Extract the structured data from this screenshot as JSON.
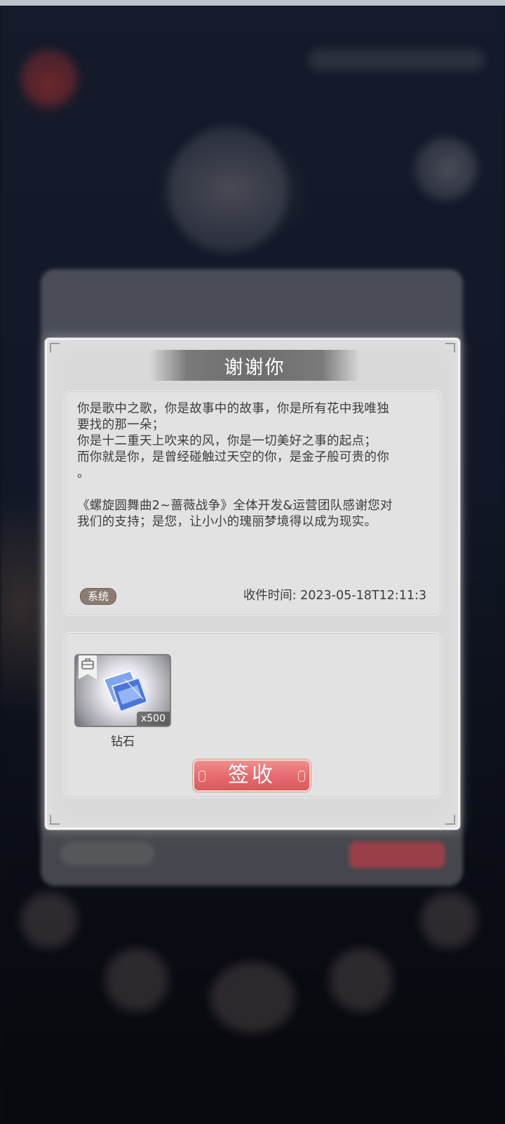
{
  "dialog": {
    "title": "谢谢你",
    "message_lines": [
      "你是歌中之歌，你是故事中的故事，你是所有花中我唯独",
      "要找的那一朵；",
      "你是十二重天上吹来的风，你是一切美好之事的起点；",
      "而你就是你，是曾经碰触过天空的你，是金子般可贵的你",
      "。"
    ],
    "message_lines_2": [
      "《螺旋圆舞曲2~蔷薇战争》全体开发&运营团队感谢您对",
      "我们的支持；是您，让小小的瑰丽梦境得以成为现实。"
    ],
    "tag": "系统",
    "receive_time": "收件时间: 2023-05-18T12:11:3"
  },
  "attachment": {
    "item_name": "钻石",
    "item_qty": "x500",
    "icon": "diamond-icon",
    "bookmark_icon": "briefcase-icon"
  },
  "actions": {
    "sign_label": "签收"
  },
  "colors": {
    "sign_button": "#e56a6d",
    "dialog_bg": "#d9d9d9",
    "title_band": "#6e6e6e",
    "tag_bg": "#8c7b72"
  }
}
